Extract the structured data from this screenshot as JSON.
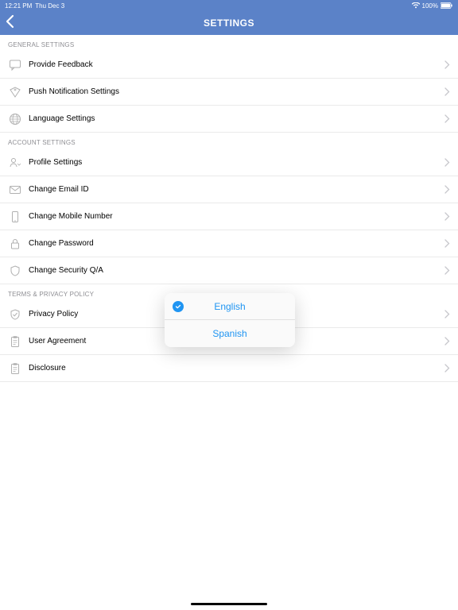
{
  "status": {
    "time": "12:21 PM",
    "date": "Thu Dec 3",
    "battery": "100%"
  },
  "header": {
    "title": "SETTINGS"
  },
  "sections": {
    "general": {
      "title": "GENERAL SETTINGS",
      "items": [
        {
          "label": "Provide Feedback"
        },
        {
          "label": "Push Notification Settings"
        },
        {
          "label": "Language Settings"
        }
      ]
    },
    "account": {
      "title": "ACCOUNT SETTINGS",
      "items": [
        {
          "label": "Profile Settings"
        },
        {
          "label": "Change Email ID"
        },
        {
          "label": "Change Mobile Number"
        },
        {
          "label": "Change Password"
        },
        {
          "label": "Change Security Q/A"
        }
      ]
    },
    "terms": {
      "title": "TERMS & PRIVACY POLICY",
      "items": [
        {
          "label": "Privacy Policy"
        },
        {
          "label": "User Agreement"
        },
        {
          "label": "Disclosure"
        }
      ]
    }
  },
  "popup": {
    "option1": "English",
    "option2": "Spanish"
  }
}
